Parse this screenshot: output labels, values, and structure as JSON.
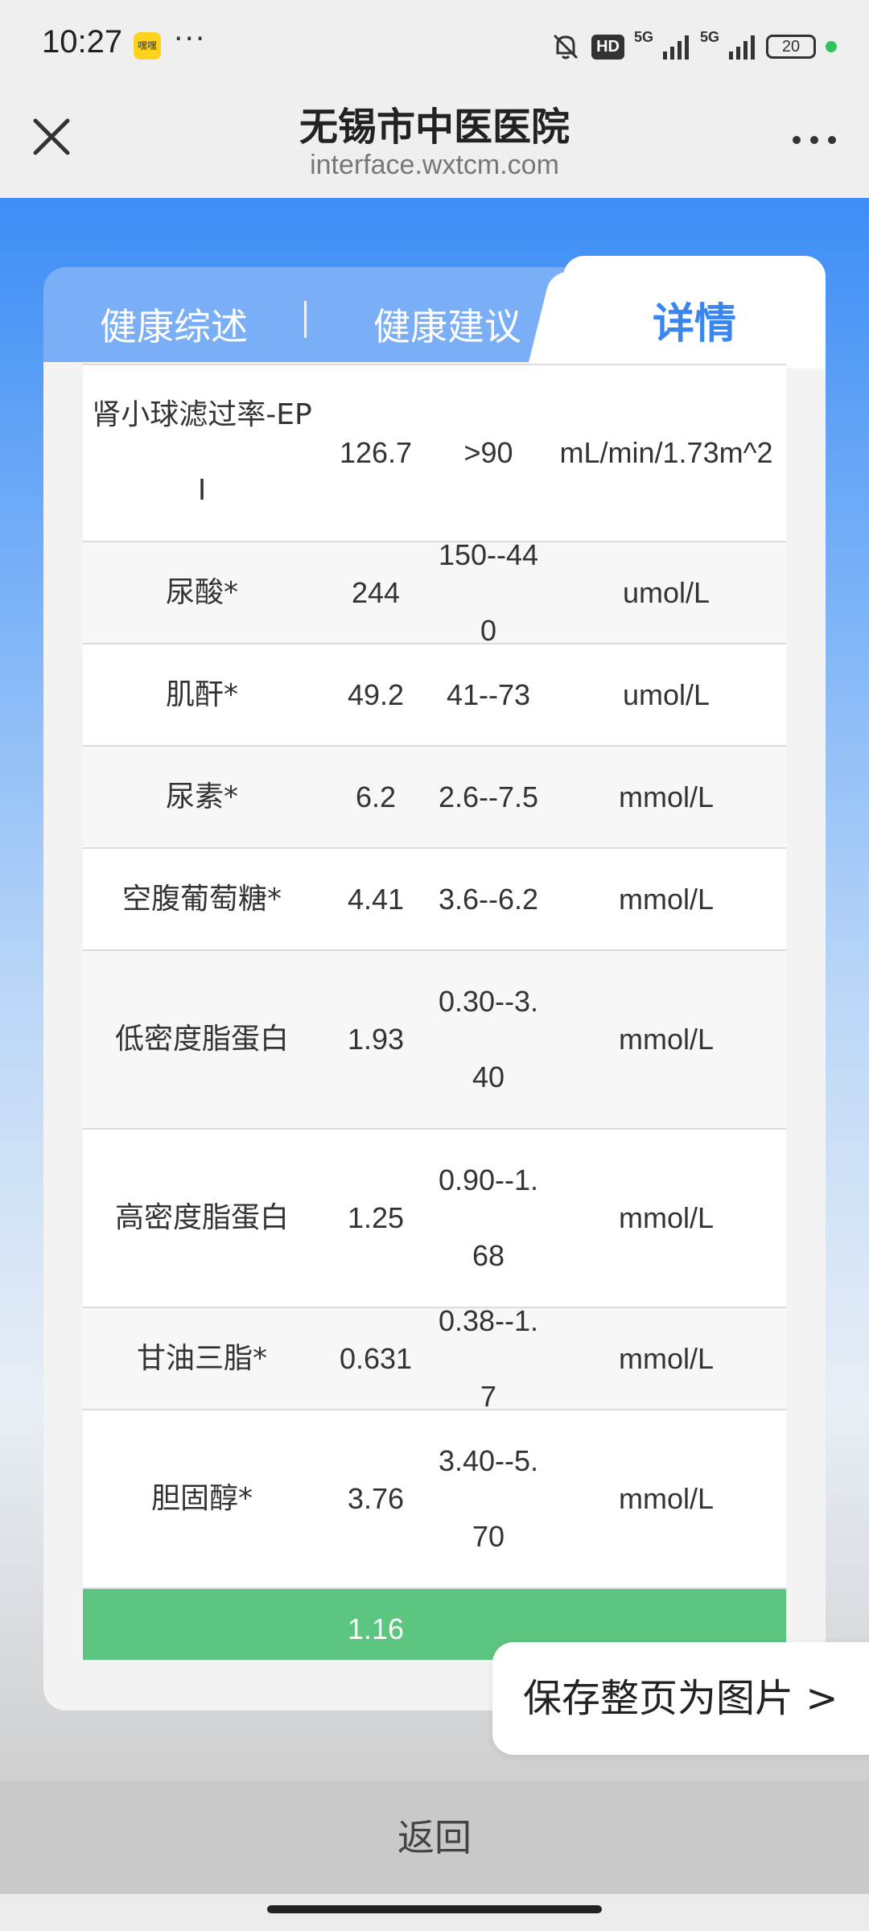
{
  "status_bar": {
    "time": "10:27",
    "app_icon_text": "嘿嘿",
    "more": "···",
    "hd": "HD",
    "net1": "5G",
    "net2": "5G",
    "battery": "20",
    "icons": [
      "bell-muted-icon",
      "signal-icon",
      "signal-icon",
      "battery-icon"
    ]
  },
  "title_bar": {
    "title": "无锡市中医医院",
    "domain": "interface.wxtcm.com"
  },
  "tabs": {
    "summary": "健康综述",
    "advice": "健康建议",
    "detail": "详情"
  },
  "table": {
    "rows": [
      {
        "name": "肾小球滤过率-EPI",
        "value": "126.7",
        "range": ">90",
        "unit": "mL/min/1.73m^2"
      },
      {
        "name": "尿酸*",
        "value": "244",
        "range": "150--440",
        "unit": "umol/L"
      },
      {
        "name": "肌酐*",
        "value": "49.2",
        "range": "41--73",
        "unit": "umol/L"
      },
      {
        "name": "尿素*",
        "value": "6.2",
        "range": "2.6--7.5",
        "unit": "mmol/L"
      },
      {
        "name": "空腹葡萄糖*",
        "value": "4.41",
        "range": "3.6--6.2",
        "unit": "mmol/L"
      },
      {
        "name": "低密度脂蛋白",
        "value": "1.93",
        "range": "0.30--3.40",
        "unit": "mmol/L"
      },
      {
        "name": "高密度脂蛋白",
        "value": "1.25",
        "range": "0.90--1.68",
        "unit": "mmol/L"
      },
      {
        "name": "甘油三脂*",
        "value": "0.631",
        "range": "0.38--1.7",
        "unit": "mmol/L"
      },
      {
        "name": "胆固醇*",
        "value": "3.76",
        "range": "3.40--5.70",
        "unit": "mmol/L"
      },
      {
        "name": "",
        "value": "1.16",
        "range": "",
        "unit": ""
      }
    ]
  },
  "save_button": "保存整页为图片 >",
  "back_button": "返回"
}
